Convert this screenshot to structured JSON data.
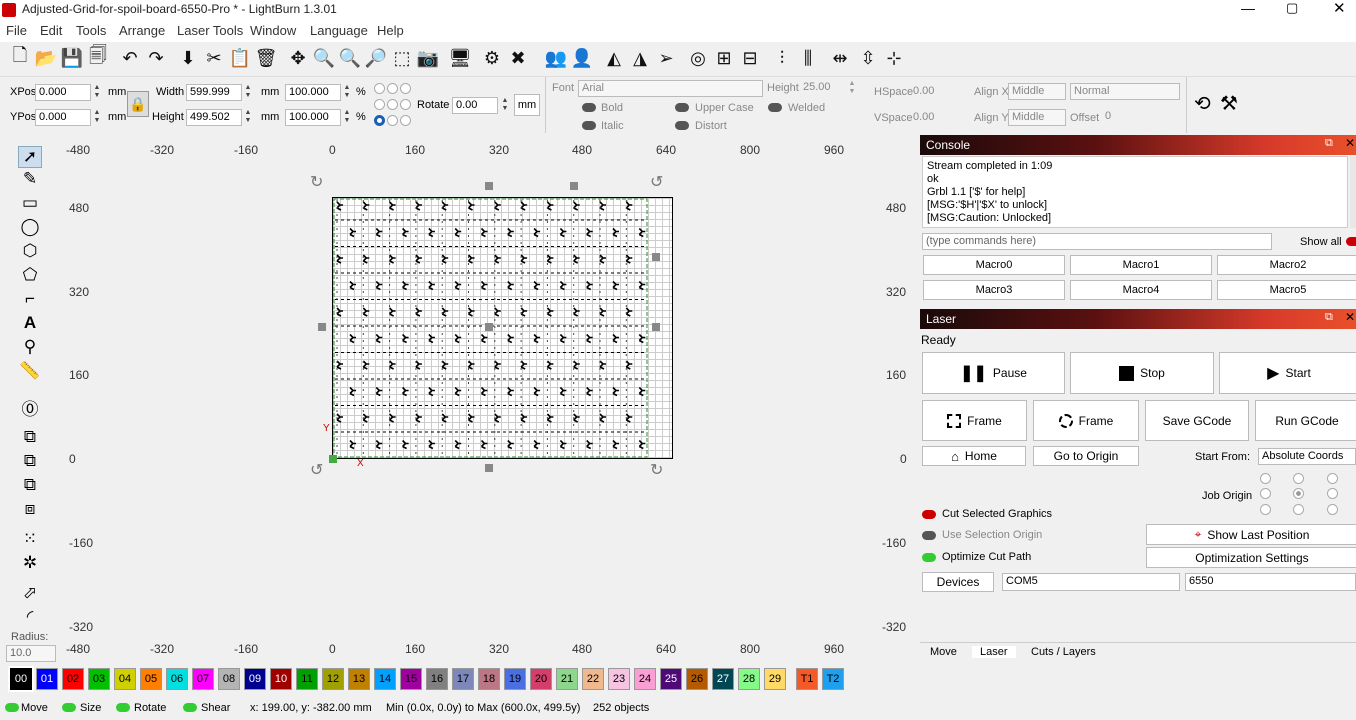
{
  "window": {
    "title": "Adjusted-Grid-for-spoil-board-6550-Pro * - LightBurn 1.3.01"
  },
  "menu": [
    "File",
    "Edit",
    "Tools",
    "Arrange",
    "Laser Tools",
    "Window",
    "Language",
    "Help"
  ],
  "props": {
    "xpos_label": "XPos",
    "xpos": "0.000",
    "ypos_label": "YPos",
    "ypos": "0.000",
    "unit": "mm",
    "width_label": "Width",
    "width": "599.999",
    "height_label": "Height",
    "height": "499.502",
    "wpct": "100.000",
    "hpct": "100.000",
    "pct": "%",
    "rotate_label": "Rotate",
    "rotate": "0.00",
    "mm_btn": "mm",
    "font_label": "Font",
    "font": "Arial",
    "fheight_label": "Height",
    "fheight": "25.00",
    "hspace_label": "HSpace",
    "hspace": "0.00",
    "vspace_label": "VSpace",
    "vspace": "0.00",
    "alignx_label": "Align X",
    "alignx": "Middle",
    "aligny_label": "Align Y",
    "aligny": "Middle",
    "normal": "Normal",
    "offset_label": "Offset",
    "offset": "0",
    "bold": "Bold",
    "italic": "Italic",
    "upper": "Upper Case",
    "distort": "Distort",
    "welded": "Welded"
  },
  "left": {
    "radius_label": "Radius:",
    "radius": "10.0"
  },
  "ruler": {
    "top": [
      "-480",
      "-320",
      "-160",
      "0",
      "160",
      "320",
      "480",
      "640",
      "800",
      "960"
    ],
    "side": [
      "480",
      "320",
      "160",
      "0",
      "-160",
      "-320"
    ]
  },
  "canvas": {
    "x_marker": "X",
    "y_marker": "Y"
  },
  "console": {
    "title": "Console",
    "lines": [
      "Stream completed in 1:09",
      "ok",
      "Grbl 1.1 ['$' for help]",
      "[MSG:'$H'|'$X' to unlock]",
      "[MSG:Caution: Unlocked]"
    ],
    "placeholder": "(type commands here)",
    "show_all": "Show all",
    "macros": [
      "Macro0",
      "Macro1",
      "Macro2",
      "Macro3",
      "Macro4",
      "Macro5"
    ]
  },
  "laser": {
    "title": "Laser",
    "status": "Ready",
    "pause": "Pause",
    "stop": "Stop",
    "start": "Start",
    "frame1": "Frame",
    "frame2": "Frame",
    "save_gcode": "Save GCode",
    "run_gcode": "Run GCode",
    "home": "Home",
    "go_origin": "Go to Origin",
    "start_from_label": "Start From:",
    "start_from": "Absolute Coords",
    "job_origin": "Job Origin",
    "cut_selected": "Cut Selected Graphics",
    "use_sel_origin": "Use Selection Origin",
    "show_last": "Show Last Position",
    "optimize": "Optimize Cut Path",
    "opt_settings": "Optimization Settings",
    "devices": "Devices",
    "port": "COM5",
    "device": "6550"
  },
  "tabs": [
    "Move",
    "Laser",
    "Cuts / Layers"
  ],
  "palette": [
    {
      "l": "00",
      "c": "#000000",
      "t": "#ffffff"
    },
    {
      "l": "01",
      "c": "#0000ff",
      "t": "#ffffff"
    },
    {
      "l": "02",
      "c": "#ff0000",
      "t": "#000"
    },
    {
      "l": "03",
      "c": "#00c000",
      "t": "#000"
    },
    {
      "l": "04",
      "c": "#d0d000",
      "t": "#000"
    },
    {
      "l": "05",
      "c": "#ff8000",
      "t": "#000"
    },
    {
      "l": "06",
      "c": "#00e0e0",
      "t": "#000"
    },
    {
      "l": "07",
      "c": "#ff00ff",
      "t": "#000"
    },
    {
      "l": "08",
      "c": "#b4b4b4",
      "t": "#000"
    },
    {
      "l": "09",
      "c": "#000090",
      "t": "#ffffff"
    },
    {
      "l": "10",
      "c": "#a00000",
      "t": "#ffffff"
    },
    {
      "l": "11",
      "c": "#00a000",
      "t": "#000"
    },
    {
      "l": "12",
      "c": "#a0a000",
      "t": "#000"
    },
    {
      "l": "13",
      "c": "#c08000",
      "t": "#000"
    },
    {
      "l": "14",
      "c": "#00a0ff",
      "t": "#000"
    },
    {
      "l": "15",
      "c": "#a000a0",
      "t": "#000"
    },
    {
      "l": "16",
      "c": "#808080",
      "t": "#000"
    },
    {
      "l": "17",
      "c": "#7d87b9",
      "t": "#000"
    },
    {
      "l": "18",
      "c": "#bb7784",
      "t": "#000"
    },
    {
      "l": "19",
      "c": "#4a6fe3",
      "t": "#000"
    },
    {
      "l": "20",
      "c": "#d33f6a",
      "t": "#000"
    },
    {
      "l": "21",
      "c": "#8cd78c",
      "t": "#000"
    },
    {
      "l": "22",
      "c": "#f0b98d",
      "t": "#000"
    },
    {
      "l": "23",
      "c": "#f6c4e1",
      "t": "#000"
    },
    {
      "l": "24",
      "c": "#fa9ed4",
      "t": "#000"
    },
    {
      "l": "25",
      "c": "#500a78",
      "t": "#ffffff"
    },
    {
      "l": "26",
      "c": "#b45a00",
      "t": "#000"
    },
    {
      "l": "27",
      "c": "#004754",
      "t": "#ffffff"
    },
    {
      "l": "28",
      "c": "#86fa88",
      "t": "#000"
    },
    {
      "l": "29",
      "c": "#ffdb66",
      "t": "#000"
    },
    {
      "l": "T1",
      "c": "#f35a28",
      "t": "#000"
    },
    {
      "l": "T2",
      "c": "#1ea0f0",
      "t": "#000"
    }
  ],
  "status": {
    "move": "Move",
    "size": "Size",
    "rotate": "Rotate",
    "shear": "Shear",
    "coords": "x: 199.00, y: -382.00 mm",
    "bounds": "Min (0.0x, 0.0y) to Max (600.0x, 499.5y)",
    "objects": "252 objects"
  }
}
